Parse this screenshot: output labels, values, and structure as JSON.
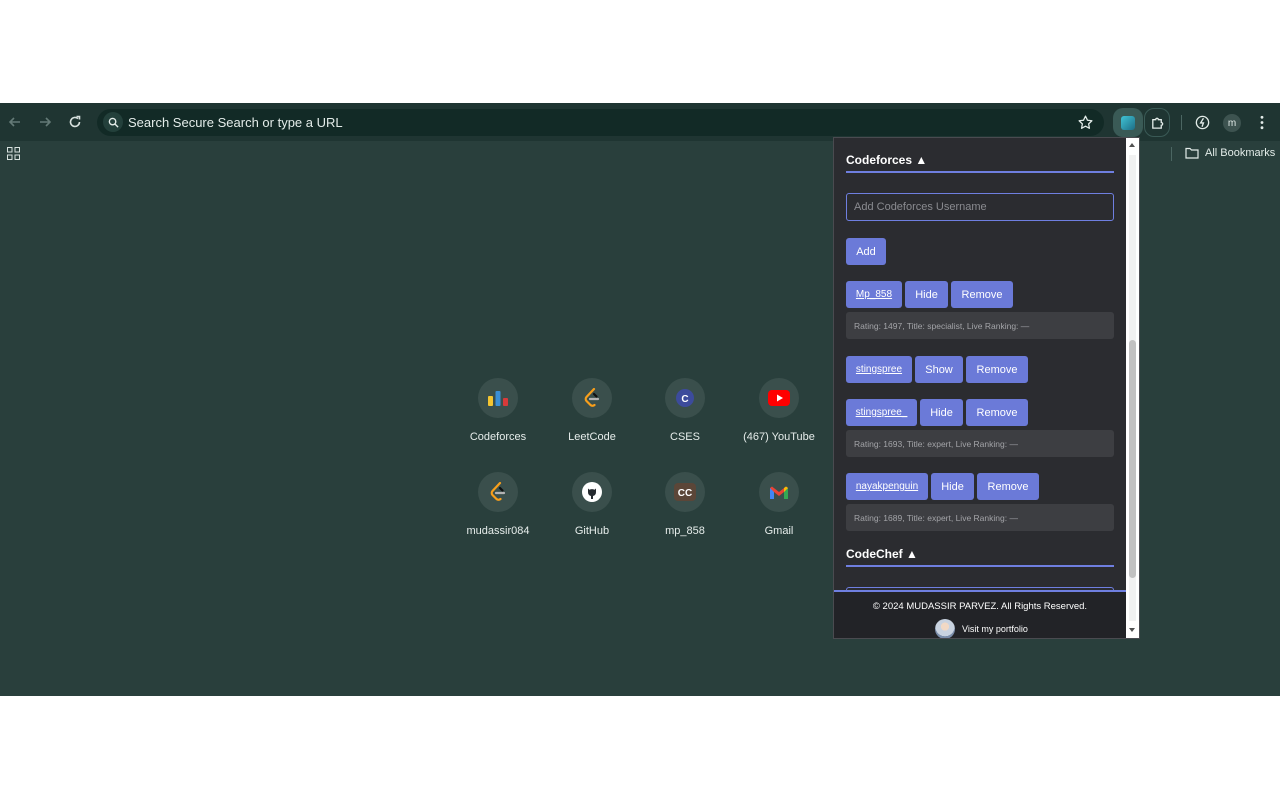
{
  "toolbar": {
    "omnibox_placeholder": "Search Secure Search or type a URL",
    "profile_initial": "m"
  },
  "bookmarks": {
    "all_bookmarks_label": "All Bookmarks"
  },
  "shortcuts": [
    {
      "label": "Codeforces",
      "icon": "codeforces-icon"
    },
    {
      "label": "LeetCode",
      "icon": "leetcode-icon"
    },
    {
      "label": "CSES",
      "icon": "cses-icon"
    },
    {
      "label": "(467) YouTube",
      "icon": "youtube-icon"
    },
    {
      "label": "mudassir084",
      "icon": "leetcode-icon"
    },
    {
      "label": "GitHub",
      "icon": "github-icon"
    },
    {
      "label": "mp_858",
      "icon": "codechef-icon"
    },
    {
      "label": "Gmail",
      "icon": "gmail-icon"
    }
  ],
  "popup": {
    "codeforces_title": "Codeforces ▲",
    "username_placeholder": "Add Codeforces Username",
    "add_label": "Add",
    "users": [
      {
        "handle": "Mp_858",
        "toggle": "Hide",
        "remove": "Remove",
        "info": "Rating: 1497, Title: specialist, Live Ranking: —"
      },
      {
        "handle": "stingspree",
        "toggle": "Show",
        "remove": "Remove",
        "info": ""
      },
      {
        "handle": "stingspree_",
        "toggle": "Hide",
        "remove": "Remove",
        "info": "Rating: 1693, Title: expert, Live Ranking: —"
      },
      {
        "handle": "nayakpenguin",
        "toggle": "Hide",
        "remove": "Remove",
        "info": "Rating: 1689, Title: expert, Live Ranking: —"
      }
    ],
    "codechef_title": "CodeChef ▲",
    "footer": {
      "copyright": "© 2024 MUDASSIR PARVEZ. All Rights Reserved.",
      "portfolio_link": "Visit my portfolio"
    }
  },
  "colors": {
    "page_bg": "#293f3c",
    "popup_bg": "#2b2c30",
    "accent": "#6b7ad8"
  }
}
